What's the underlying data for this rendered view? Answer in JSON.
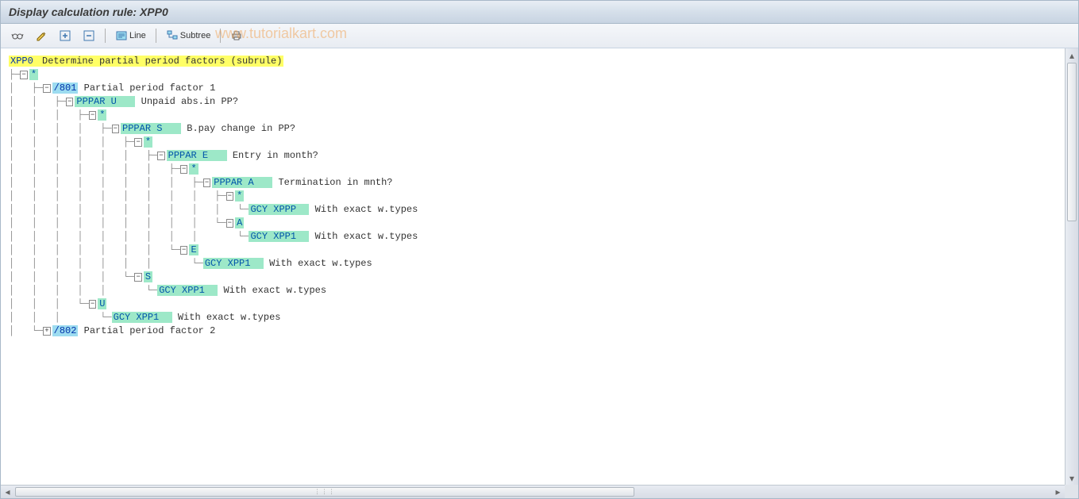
{
  "title": "Display calculation rule: XPP0",
  "watermark": "www.tutorialkart.com",
  "toolbar": {
    "line_label": "Line",
    "subtree_label": "Subtree"
  },
  "tree": {
    "root": {
      "code": "XPP0",
      "desc": "Determine partial period factors (subrule)"
    },
    "nodes": [
      {
        "indent": 0,
        "box": "⊟",
        "code": "*",
        "cls": "green",
        "desc": ""
      },
      {
        "indent": 1,
        "box": "⊟",
        "code": "/801",
        "cls": "blue",
        "desc": "Partial period factor 1"
      },
      {
        "indent": 2,
        "box": "⊟",
        "code": "PPPAR U",
        "cls": "green",
        "pad": 3,
        "desc": "Unpaid abs.in PP?"
      },
      {
        "indent": 3,
        "box": "⊟",
        "code": "*",
        "cls": "green",
        "desc": ""
      },
      {
        "indent": 4,
        "box": "⊟",
        "code": "PPPAR S",
        "cls": "green",
        "pad": 3,
        "desc": "B.pay change in PP?"
      },
      {
        "indent": 5,
        "box": "⊟",
        "code": "*",
        "cls": "green",
        "desc": ""
      },
      {
        "indent": 6,
        "box": "⊟",
        "code": "PPPAR E",
        "cls": "green",
        "pad": 3,
        "desc": "Entry in month?"
      },
      {
        "indent": 7,
        "box": "⊟",
        "code": "*",
        "cls": "green",
        "desc": ""
      },
      {
        "indent": 8,
        "box": "⊟",
        "code": "PPPAR A",
        "cls": "green",
        "pad": 3,
        "desc": "Termination in mnth?"
      },
      {
        "indent": 9,
        "box": "⊟",
        "code": "*",
        "cls": "green",
        "desc": ""
      },
      {
        "indent": 10,
        "last": true,
        "code": "GCY XPPP",
        "cls": "green",
        "pad": 2,
        "desc": "With exact w.types"
      },
      {
        "indent": 9,
        "last": true,
        "box": "⊟",
        "code": "A",
        "cls": "green",
        "desc": ""
      },
      {
        "indent": 10,
        "last": true,
        "code": "GCY XPP1",
        "cls": "green",
        "pad": 2,
        "desc": "With exact w.types"
      },
      {
        "indent": 7,
        "last": true,
        "box": "⊟",
        "code": "E",
        "cls": "green",
        "desc": ""
      },
      {
        "indent": 8,
        "last": true,
        "code": "GCY XPP1",
        "cls": "green",
        "pad": 2,
        "desc": "With exact w.types"
      },
      {
        "indent": 5,
        "last": true,
        "box": "⊟",
        "code": "S",
        "cls": "green",
        "desc": ""
      },
      {
        "indent": 6,
        "last": true,
        "code": "GCY XPP1",
        "cls": "green",
        "pad": 2,
        "desc": "With exact w.types"
      },
      {
        "indent": 3,
        "last": true,
        "box": "⊟",
        "code": "U",
        "cls": "green",
        "desc": ""
      },
      {
        "indent": 4,
        "last": true,
        "code": "GCY XPP1",
        "cls": "green",
        "pad": 2,
        "desc": "With exact w.types"
      },
      {
        "indent": 1,
        "last": true,
        "box": "⊞",
        "code": "/802",
        "cls": "blue",
        "desc": "Partial period factor 2"
      }
    ]
  }
}
